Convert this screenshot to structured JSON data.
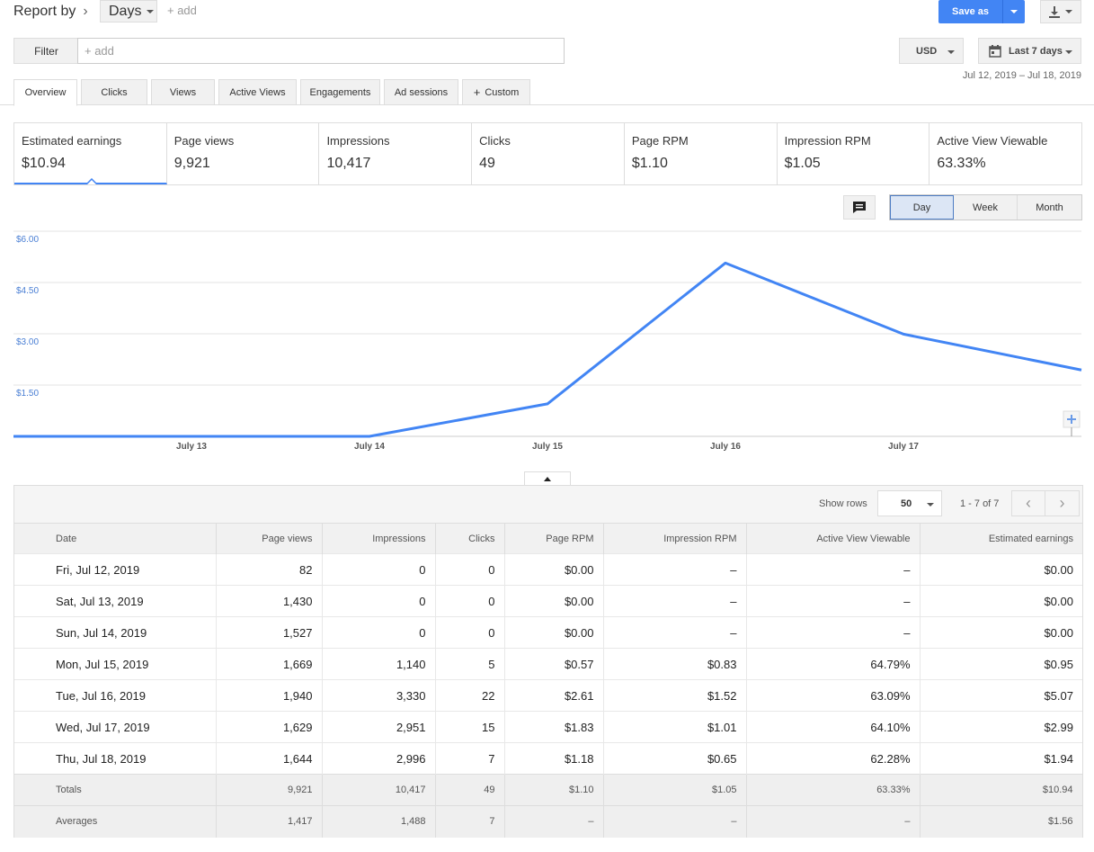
{
  "header": {
    "report_by": "Report by",
    "dimension": "Days",
    "add_dimension": "+ add",
    "save_as": "Save as"
  },
  "filter": {
    "button": "Filter",
    "placeholder": "+ add"
  },
  "currency": "USD",
  "date_range": {
    "label": "Last 7 days",
    "range": "Jul 12, 2019 – Jul 18, 2019"
  },
  "tabs": [
    "Overview",
    "Clicks",
    "Views",
    "Active Views",
    "Engagements",
    "Ad sessions",
    "Custom"
  ],
  "metrics": [
    {
      "label": "Estimated earnings",
      "value": "$10.94"
    },
    {
      "label": "Page views",
      "value": "9,921"
    },
    {
      "label": "Impressions",
      "value": "10,417"
    },
    {
      "label": "Clicks",
      "value": "49"
    },
    {
      "label": "Page RPM",
      "value": "$1.10"
    },
    {
      "label": "Impression RPM",
      "value": "$1.05"
    },
    {
      "label": "Active View Viewable",
      "value": "63.33%"
    }
  ],
  "granularity": [
    "Day",
    "Week",
    "Month"
  ],
  "chart_data": {
    "type": "line",
    "x": [
      "July 12",
      "July 13",
      "July 14",
      "July 15",
      "July 16",
      "July 17",
      "July 18"
    ],
    "x_tick_labels": [
      "July 13",
      "July 14",
      "July 15",
      "July 16",
      "July 17"
    ],
    "y_tick_labels": [
      "$1.50",
      "$3.00",
      "$4.50",
      "$6.00"
    ],
    "series": [
      {
        "values": [
          0.0,
          0.0,
          0.0,
          0.95,
          5.07,
          2.99,
          1.94
        ]
      }
    ],
    "ylim": [
      0,
      6
    ],
    "grid": true,
    "color": "#4285f4"
  },
  "table_controls": {
    "show_rows_label": "Show rows",
    "rows_value": "50",
    "page_info": "1 - 7 of 7"
  },
  "table": {
    "columns": [
      "Date",
      "Page views",
      "Impressions",
      "Clicks",
      "Page RPM",
      "Impression RPM",
      "Active View Viewable",
      "Estimated earnings"
    ],
    "rows": [
      [
        "Fri, Jul 12, 2019",
        "82",
        "0",
        "0",
        "$0.00",
        "–",
        "–",
        "$0.00"
      ],
      [
        "Sat, Jul 13, 2019",
        "1,430",
        "0",
        "0",
        "$0.00",
        "–",
        "–",
        "$0.00"
      ],
      [
        "Sun, Jul 14, 2019",
        "1,527",
        "0",
        "0",
        "$0.00",
        "–",
        "–",
        "$0.00"
      ],
      [
        "Mon, Jul 15, 2019",
        "1,669",
        "1,140",
        "5",
        "$0.57",
        "$0.83",
        "64.79%",
        "$0.95"
      ],
      [
        "Tue, Jul 16, 2019",
        "1,940",
        "3,330",
        "22",
        "$2.61",
        "$1.52",
        "63.09%",
        "$5.07"
      ],
      [
        "Wed, Jul 17, 2019",
        "1,629",
        "2,951",
        "15",
        "$1.83",
        "$1.01",
        "64.10%",
        "$2.99"
      ],
      [
        "Thu, Jul 18, 2019",
        "1,644",
        "2,996",
        "7",
        "$1.18",
        "$0.65",
        "62.28%",
        "$1.94"
      ]
    ],
    "totals": [
      "Totals",
      "9,921",
      "10,417",
      "49",
      "$1.10",
      "$1.05",
      "63.33%",
      "$10.94"
    ],
    "averages": [
      "Averages",
      "1,417",
      "1,488",
      "7",
      "–",
      "–",
      "–",
      "$1.56"
    ]
  }
}
